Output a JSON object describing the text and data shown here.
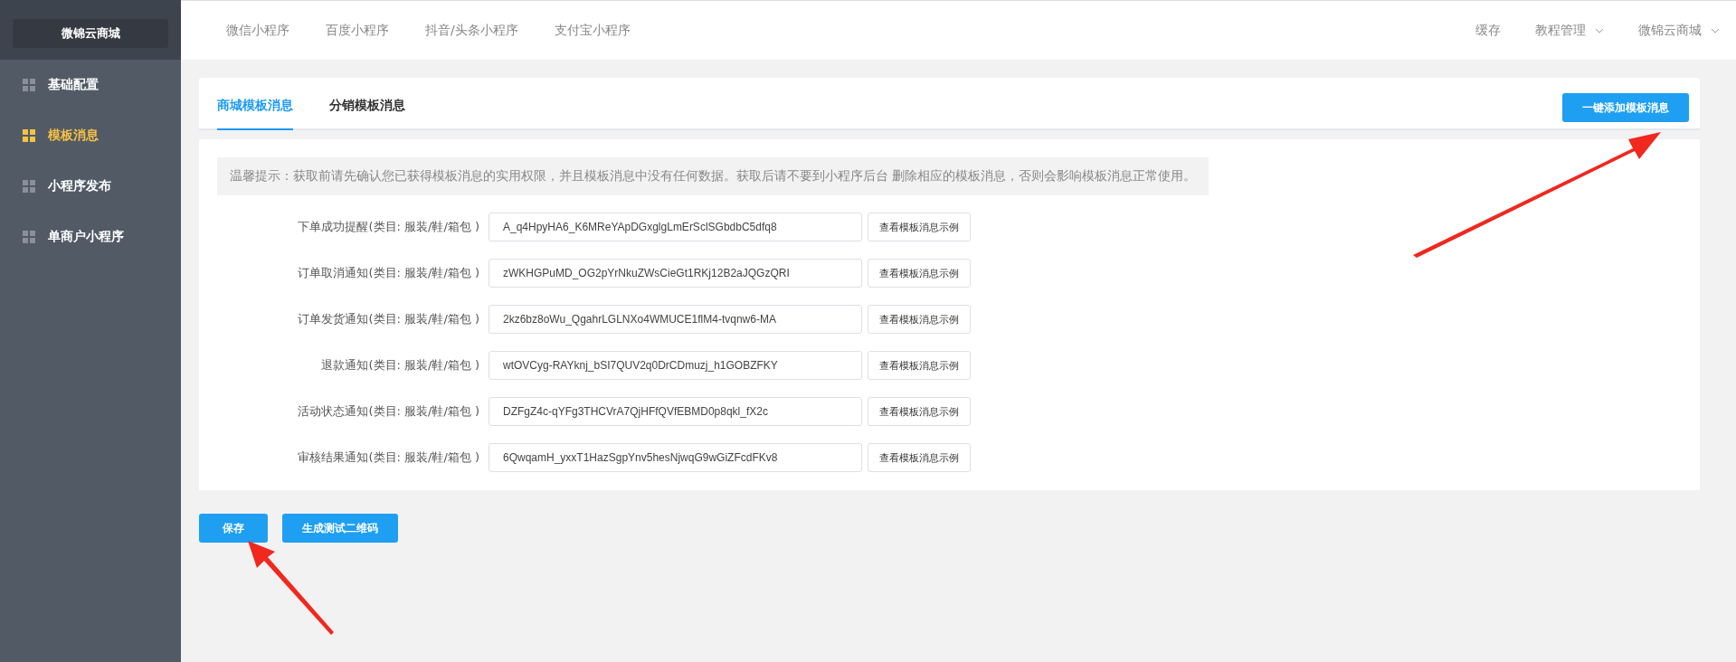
{
  "sidebar": {
    "logo": "微锦云商城",
    "items": [
      {
        "label": "基础配置",
        "selected": false
      },
      {
        "label": "模板消息",
        "selected": true
      },
      {
        "label": "小程序发布",
        "selected": false
      },
      {
        "label": "单商户小程序",
        "selected": false
      }
    ]
  },
  "top_nav": {
    "tabs": [
      {
        "label": "微信小程序"
      },
      {
        "label": "百度小程序"
      },
      {
        "label": "抖音/头条小程序"
      },
      {
        "label": "支付宝小程序"
      }
    ],
    "right": [
      {
        "label": "缓存",
        "dropdown": false
      },
      {
        "label": "教程管理",
        "dropdown": true
      },
      {
        "label": "微锦云商城",
        "dropdown": true
      }
    ]
  },
  "tabs": [
    {
      "label": "商城模板消息",
      "selected": true
    },
    {
      "label": "分销模板消息",
      "selected": false
    }
  ],
  "add_button": "一键添加模板消息",
  "notice": "温馨提示：获取前请先确认您已获得模板消息的实用权限，并且模板消息中没有任何数据。获取后请不要到小程序后台 删除相应的模板消息，否则会影响模板消息正常使用。",
  "rows": [
    {
      "label": "下单成功提醒(类目: 服装/鞋/箱包 )",
      "value": "A_q4HpyHA6_K6MReYApDGxglgLmErSclSGbdbC5dfq8",
      "button": "查看模板消息示例"
    },
    {
      "label": "订单取消通知(类目: 服装/鞋/箱包 )",
      "value": "zWKHGPuMD_OG2pYrNkuZWsCieGt1RKj12B2aJQGzQRI",
      "button": "查看模板消息示例"
    },
    {
      "label": "订单发货通知(类目: 服装/鞋/箱包 )",
      "value": "2kz6bz8oWu_QgahrLGLNXo4WMUCE1flM4-tvqnw6-MA",
      "button": "查看模板消息示例"
    },
    {
      "label": "退款通知(类目: 服装/鞋/箱包 )",
      "value": "wtOVCyg-RAYknj_bSI7QUV2q0DrCDmuzj_h1GOBZFKY",
      "button": "查看模板消息示例"
    },
    {
      "label": "活动状态通知(类目: 服装/鞋/箱包 )",
      "value": "DZFgZ4c-qYFg3THCVrA7QjHFfQVfEBMD0p8qkl_fX2c",
      "button": "查看模板消息示例"
    },
    {
      "label": "审核结果通知(类目: 服装/鞋/箱包 )",
      "value": "6QwqamH_yxxT1HazSgpYnv5hesNjwqG9wGiZFcdFKv8",
      "button": "查看模板消息示例"
    }
  ],
  "footer_buttons": [
    "保存",
    "生成测试二维码"
  ]
}
